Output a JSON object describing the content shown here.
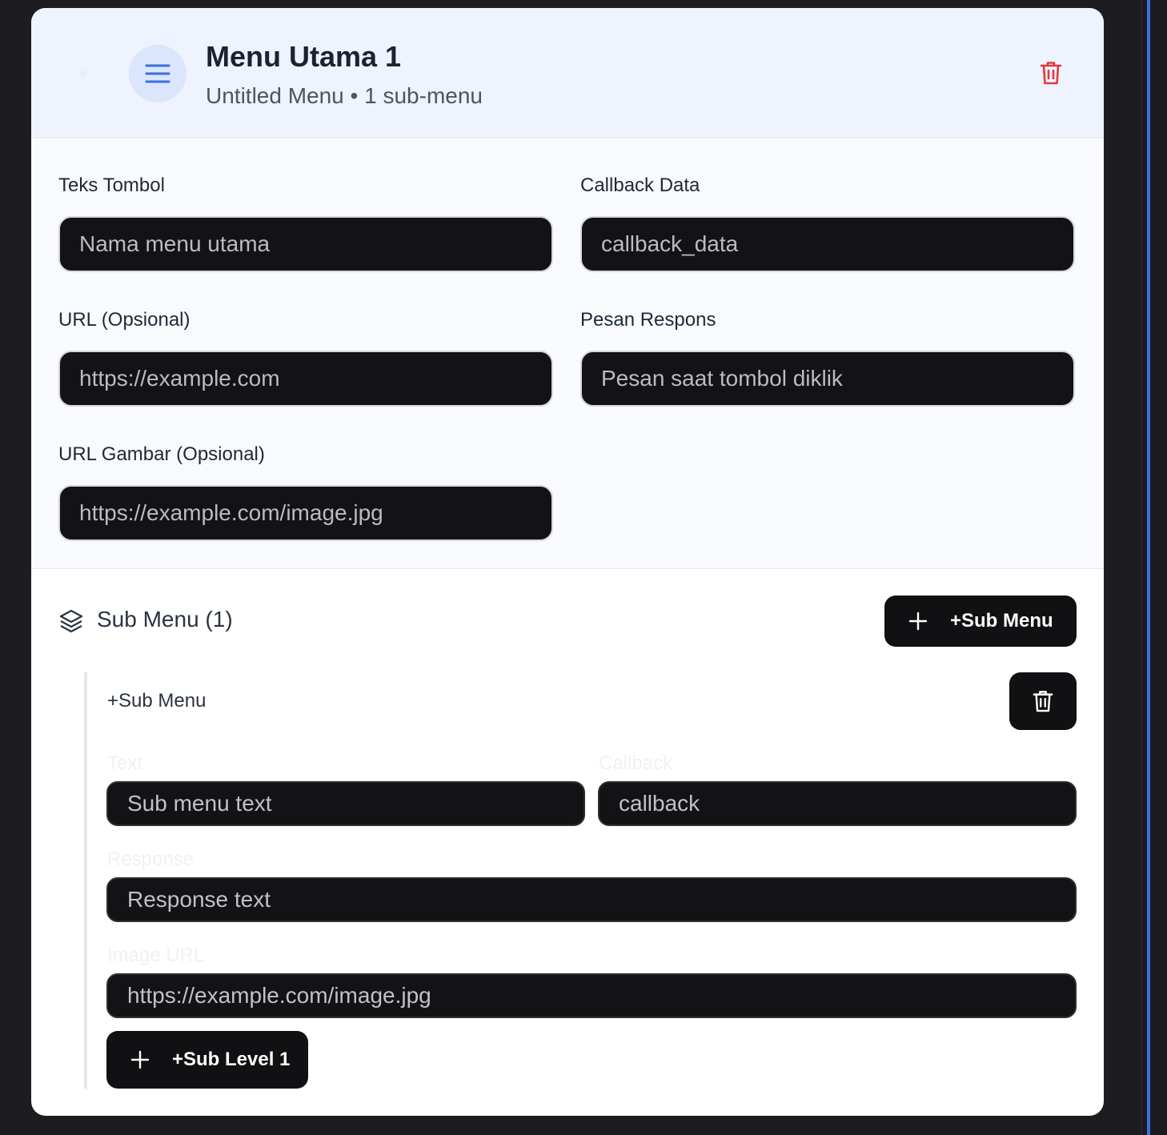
{
  "menu": {
    "title": "Menu Utama 1",
    "subtitle": "Untitled Menu • 1 sub-menu"
  },
  "fields": {
    "button_text": {
      "label": "Teks Tombol",
      "placeholder": "Nama menu utama"
    },
    "callback_data": {
      "label": "Callback Data",
      "placeholder": "callback_data"
    },
    "url": {
      "label": "URL (Opsional)",
      "placeholder": "https://example.com"
    },
    "response_message": {
      "label": "Pesan Respons",
      "placeholder": "Pesan saat tombol diklik"
    },
    "image_url": {
      "label": "URL Gambar (Opsional)",
      "placeholder": "https://example.com/image.jpg"
    }
  },
  "submenu_section": {
    "title": "Sub Menu (1)",
    "add_button_label": "+Sub Menu"
  },
  "submenu_item": {
    "name": "+Sub Menu",
    "text": {
      "label": "Text",
      "placeholder": "Sub menu text"
    },
    "callback": {
      "label": "Callback",
      "placeholder": "callback"
    },
    "response": {
      "label": "Response",
      "placeholder": "Response text"
    },
    "image_url": {
      "label": "Image URL",
      "placeholder": "https://example.com/image.jpg"
    },
    "add_level_button_label": "+Sub Level 1"
  },
  "colors": {
    "accent": "#3b6fe0",
    "delete": "#e0393e",
    "header_bg": "#eef3fe"
  }
}
